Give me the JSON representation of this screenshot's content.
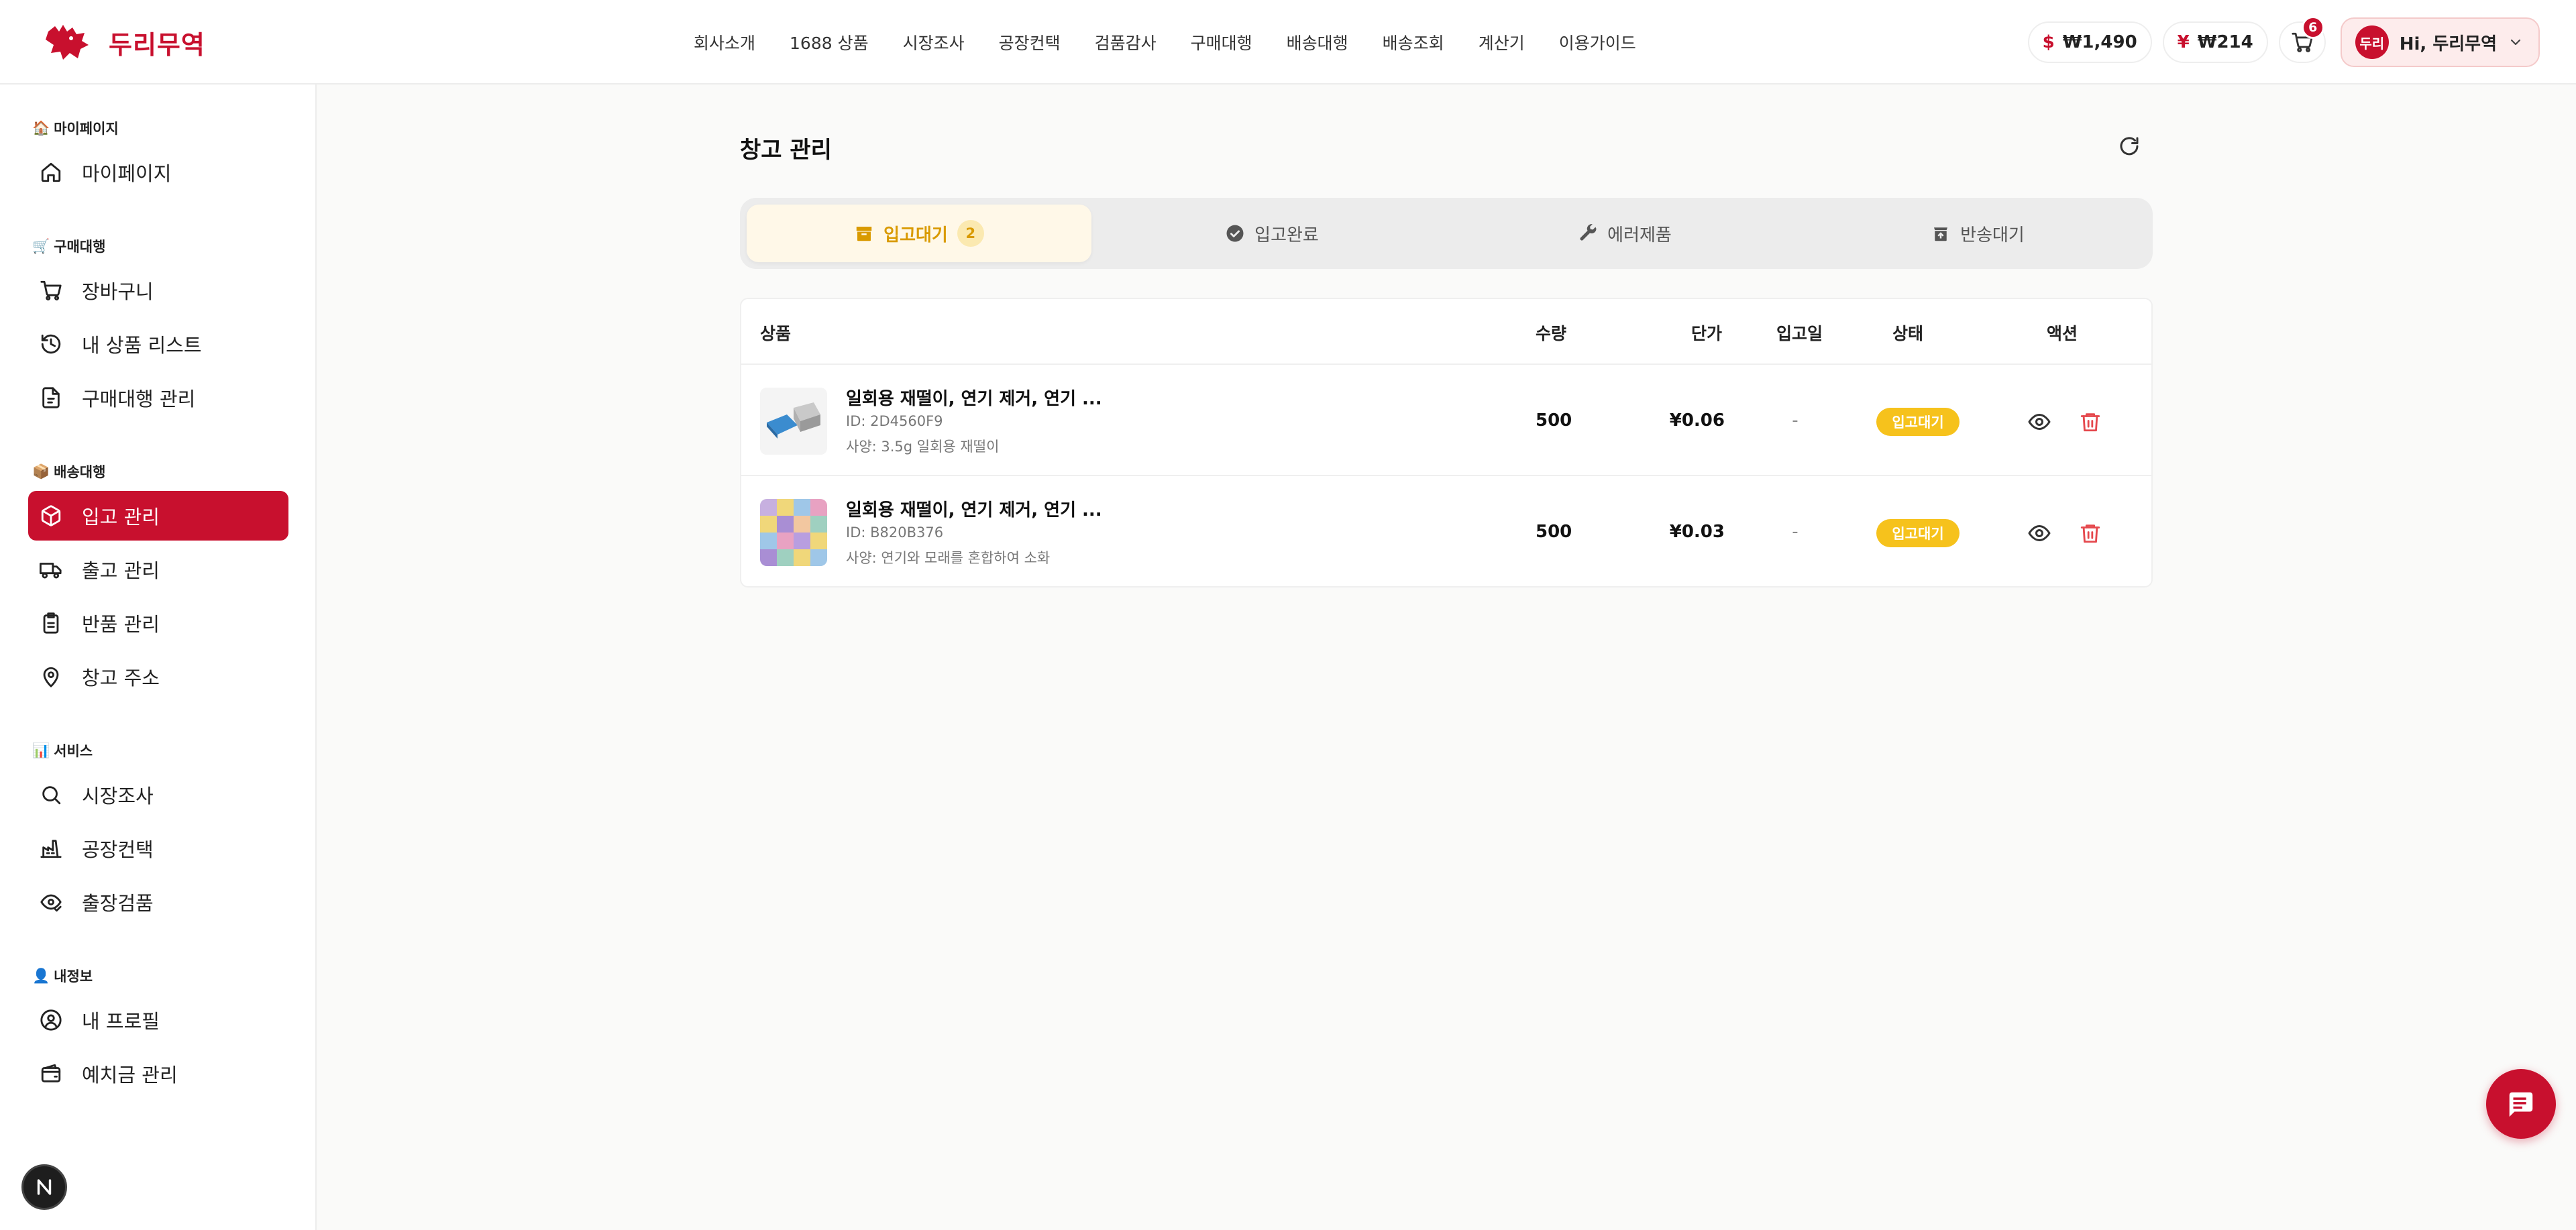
{
  "brand": {
    "name": "두리무역"
  },
  "nav": {
    "items": [
      "회사소개",
      "1688 상품",
      "시장조사",
      "공장컨택",
      "검품감사",
      "구매대행",
      "배송대행",
      "배송조회",
      "계산기",
      "이용가이드"
    ]
  },
  "header": {
    "usd_balance": "₩1,490",
    "cny_balance": "₩214",
    "cart_count": "6",
    "avatar_label": "두리",
    "user_greeting": "Hi, 두리무역"
  },
  "sidebar": {
    "sections": [
      {
        "title": "마이페이지",
        "emoji": "🏠",
        "items": [
          {
            "label": "마이페이지",
            "icon": "home-icon"
          }
        ]
      },
      {
        "title": "구매대행",
        "emoji": "🛒",
        "items": [
          {
            "label": "장바구니",
            "icon": "cart-icon"
          },
          {
            "label": "내 상품 리스트",
            "icon": "history-icon"
          },
          {
            "label": "구매대행 관리",
            "icon": "document-icon"
          }
        ]
      },
      {
        "title": "배송대행",
        "emoji": "📦",
        "items": [
          {
            "label": "입고 관리",
            "icon": "package-icon",
            "active": true
          },
          {
            "label": "출고 관리",
            "icon": "truck-icon"
          },
          {
            "label": "반품 관리",
            "icon": "clipboard-icon"
          },
          {
            "label": "창고 주소",
            "icon": "map-pin-icon"
          }
        ]
      },
      {
        "title": "서비스",
        "emoji": "📊",
        "items": [
          {
            "label": "시장조사",
            "icon": "search-icon"
          },
          {
            "label": "공장컨택",
            "icon": "factory-icon"
          },
          {
            "label": "출장검품",
            "icon": "eye-check-icon"
          }
        ]
      },
      {
        "title": "내정보",
        "emoji": "👤",
        "items": [
          {
            "label": "내 프로필",
            "icon": "user-circle-icon"
          },
          {
            "label": "예치금 관리",
            "icon": "wallet-icon"
          }
        ]
      }
    ]
  },
  "page": {
    "title": "창고 관리",
    "tabs": [
      {
        "label": "입고대기",
        "count": "2",
        "icon": "box-icon",
        "active": true
      },
      {
        "label": "입고완료",
        "icon": "check-circle-icon"
      },
      {
        "label": "에러제품",
        "icon": "wrench-icon"
      },
      {
        "label": "반송대기",
        "icon": "return-box-icon"
      }
    ]
  },
  "table": {
    "headers": {
      "product": "상품",
      "qty": "수량",
      "price": "단가",
      "date": "입고일",
      "status": "상태",
      "action": "액션"
    },
    "rows": [
      {
        "name": "일회용 재떨이, 연기 제거, 연기 ...",
        "id": "ID: 2D4560F9",
        "spec": "사양: 3.5g 일회용 재떨이",
        "qty": "500",
        "price": "¥0.06",
        "date": "-",
        "status": "입고대기"
      },
      {
        "name": "일회용 재떨이, 연기 제거, 연기 ...",
        "id": "ID: B820B376",
        "spec": "사양: 연기와 모래를 혼합하여 소화",
        "qty": "500",
        "price": "¥0.03",
        "date": "-",
        "status": "입고대기"
      }
    ]
  },
  "colors": {
    "brand_red": "#c8102e",
    "pending_yellow": "#f6c21c",
    "tab_active_text": "#d99a00",
    "delete_red": "#e5484d"
  }
}
